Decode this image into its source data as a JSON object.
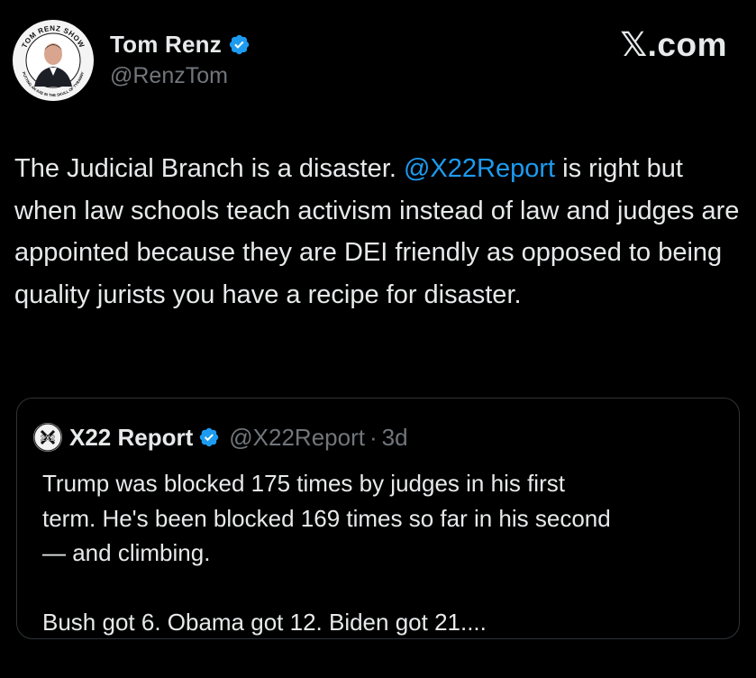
{
  "author": {
    "display_name": "Tom Renz",
    "handle": "@RenzTom",
    "verified": true,
    "avatar": {
      "icon": "avatar-photo",
      "ring_text_top": "TOM RENZ SHOW",
      "ring_text_bottom": "PUTTING AN AXE IN THE SKULL OF TYRANNY"
    }
  },
  "brand": {
    "label": "𝕏.com"
  },
  "tweet": {
    "text_before": "The Judicial Branch is a disaster. ",
    "mention": "@X22Report",
    "text_after": " is right but when law schools teach activism instead of law and judges are appointed because they are DEI friendly as opposed to being quality jurists you have a recipe for disaster."
  },
  "quoted_tweet": {
    "display_name": "X22 Report",
    "handle": "@X22Report",
    "separator": "·",
    "time": "3d",
    "verified": true,
    "avatar_label": "2X2",
    "lines": [
      "Trump was blocked 175 times by judges in his first",
      "term. He's been blocked 169 times so far in his second",
      "— and climbing."
    ],
    "last_line": "Bush got 6. Obama got 12. Biden got 21...."
  },
  "colors": {
    "background": "#000000",
    "text": "#e7e9ea",
    "secondary": "#71767b",
    "accent": "#1d9bf0",
    "border": "#2f3336"
  }
}
